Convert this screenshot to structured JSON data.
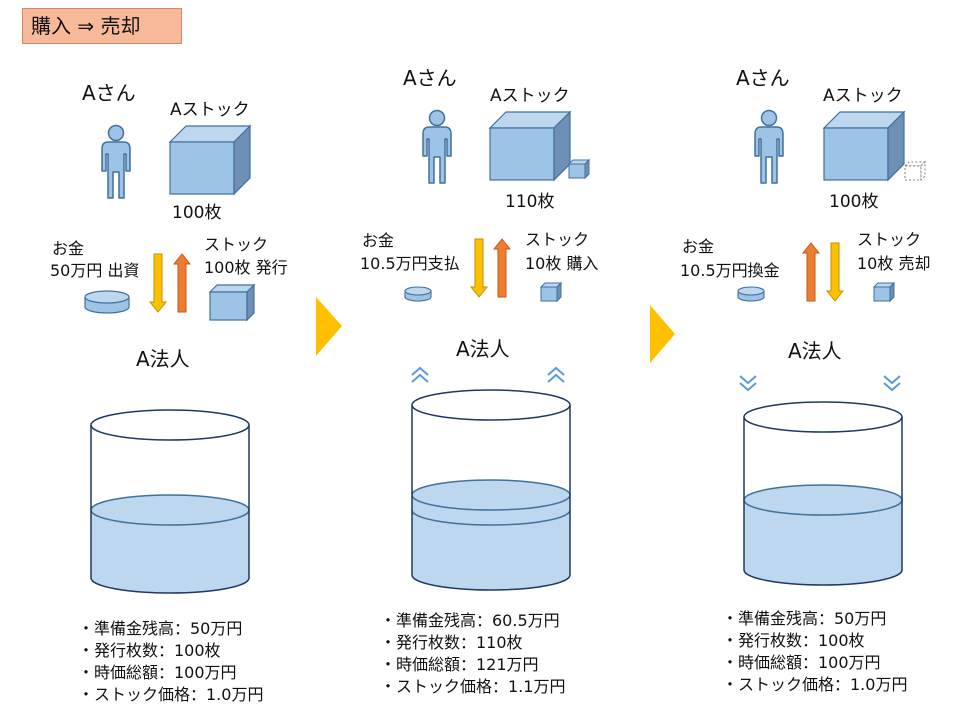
{
  "title": "購入 ⇒ 売却",
  "panels": [
    {
      "person": "Aさん",
      "stock_label": "Aストック",
      "stock_count": "100枚",
      "money_label": "お金",
      "money_action": "50万円 出資",
      "stock_flow_label": "ストック",
      "stock_flow_action": "100枚 発行",
      "corp": "A法人",
      "info": [
        "・準備金残高：50万円",
        "・発行枚数：100枚",
        "・時価総額：100万円",
        "・ストック価格：1.0万円"
      ]
    },
    {
      "person": "Aさん",
      "stock_label": "Aストック",
      "stock_count": "110枚",
      "money_label": "お金",
      "money_action": "10.5万円支払",
      "stock_flow_label": "ストック",
      "stock_flow_action": "10枚 購入",
      "corp": "A法人",
      "info": [
        "・準備金残高：60.5万円",
        "・発行枚数：110枚",
        "・時価総額：121万円",
        "・ストック価格：1.1万円"
      ]
    },
    {
      "person": "Aさん",
      "stock_label": "Aストック",
      "stock_count": "100枚",
      "money_label": "お金",
      "money_action": "10.5万円換金",
      "stock_flow_label": "ストック",
      "stock_flow_action": "10枚 売却",
      "corp": "A法人",
      "info": [
        "・準備金残高：50万円",
        "・発行枚数：100枚",
        "・時価総額：100万円",
        "・ストック価格：1.0万円"
      ]
    }
  ],
  "colors": {
    "person_fill": "#9dc3e6",
    "person_stroke": "#41719c",
    "cube_front": "#9dc3e6",
    "cube_top": "#bdd7ee",
    "cube_side": "#6f8fb4",
    "arrow_orange": "#ed7d31",
    "arrow_gold": "#ffc000",
    "water": "#bdd7ee",
    "tank_stroke": "#1f3864",
    "next_arrow": "#ffc000"
  }
}
